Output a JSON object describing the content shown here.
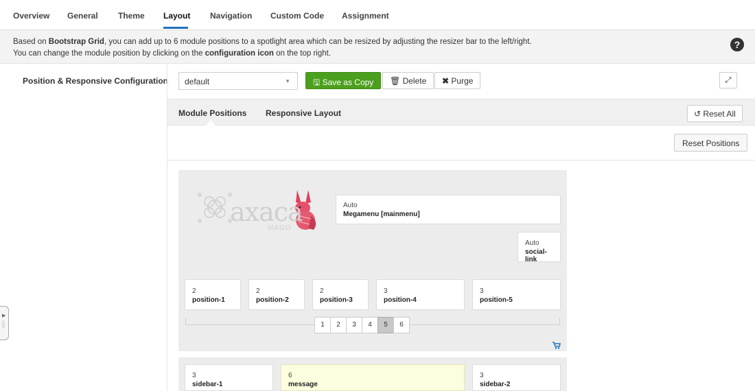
{
  "tabs": [
    "Overview",
    "General",
    "Theme",
    "Layout",
    "Navigation",
    "Custom Code",
    "Assignment"
  ],
  "info": {
    "line1_pre": "Based on ",
    "line1_bold": "Bootstrap Grid",
    "line1_post": ", you can add up to 6 module positions to a spotlight area which can be resized by adjusting the resizer bar to the left/right.",
    "line2_pre": "You can change the module position by clicking on the ",
    "line2_bold": "configuration icon",
    "line2_post": " on the top right."
  },
  "side_label": "Position & Responsive Configuration",
  "toolbar": {
    "select_value": "default",
    "save_copy": "Save as Copy",
    "delete": "Delete",
    "purge": "Purge"
  },
  "subtabs": [
    "Module Positions",
    "Responsive Layout"
  ],
  "reset_all": "Reset All",
  "reset_positions": "Reset Positions",
  "logo": {
    "text": "axaca",
    "sub": "MAGO"
  },
  "header_positions": [
    {
      "width": "Auto",
      "name": "Megamenu [mainmenu]"
    },
    {
      "width": "Auto",
      "name": "social-link"
    }
  ],
  "spotlight": [
    {
      "width": "2",
      "name": "position-1"
    },
    {
      "width": "2",
      "name": "position-2"
    },
    {
      "width": "2",
      "name": "position-3"
    },
    {
      "width": "3",
      "name": "position-4"
    },
    {
      "width": "3",
      "name": "position-5"
    }
  ],
  "number_buttons": [
    "1",
    "2",
    "3",
    "4",
    "5",
    "6"
  ],
  "active_number": "5",
  "main_positions": [
    {
      "width": "3",
      "name": "sidebar-1"
    },
    {
      "width": "6",
      "name": "message"
    },
    {
      "width": "3",
      "name": "sidebar-2"
    }
  ],
  "colors": {
    "accent": "#1e73be",
    "save_green": "#4b9f1e",
    "highlight": "#fdfde0"
  }
}
